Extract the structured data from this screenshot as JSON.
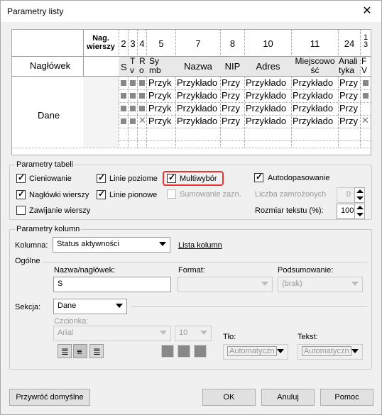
{
  "window": {
    "title": "Parametry listy"
  },
  "preview": {
    "header_row_label": "Nagłówek",
    "data_row_label": "Dane",
    "nag_wierszy": "Nag.\nwierszy",
    "columns": [
      {
        "num": "2",
        "name": "S"
      },
      {
        "num": "3",
        "name": "T\nv"
      },
      {
        "num": "4",
        "name": "R\no"
      },
      {
        "num": "5",
        "name": "Sy\nmb"
      },
      {
        "num": "7",
        "name": "Nazwa"
      },
      {
        "num": "8",
        "name": "NIP"
      },
      {
        "num": "10",
        "name": "Adres"
      },
      {
        "num": "11",
        "name": "Miejscowo\nść"
      },
      {
        "num": "24",
        "name": "Anali\ntyka"
      },
      {
        "num": "1\n3",
        "name": "F\nV"
      }
    ],
    "cells": {
      "symb": "Przyk",
      "nazwa": "Przykłado",
      "nip": "Przy",
      "adres": "Przykłado",
      "miejsc": "Przykłado",
      "anal": "Przy"
    }
  },
  "table_params": {
    "title": "Parametry tabeli",
    "cieniowanie": "Cieniowanie",
    "linie_poziome": "Linie poziome",
    "multiwybor": "Multiwybór",
    "autodopasowanie": "Autodopasowanie",
    "naglowki_wierszy": "Nagłówki wierszy",
    "linie_pionowe": "Linie pionowe",
    "sumowanie": "Sumowanie zazn.",
    "liczba_zamrozonych": "Liczba zamrożonych",
    "liczba_value": "0",
    "zawijanie": "Zawijanie wierszy",
    "rozmiar_tekstu": "Rozmiar tekstu (%):",
    "rozmiar_value": "100"
  },
  "column_params": {
    "title": "Parametry kolumn",
    "kolumna_label": "Kolumna:",
    "kolumna_value": "Status aktywności",
    "lista_kolumn": "Lista kolumn",
    "ogolne": "Ogólne",
    "nazwa_label": "Nazwa/nagłówek:",
    "nazwa_value": "S",
    "format_label": "Format:",
    "format_value": "",
    "podsumowanie_label": "Podsumowanie:",
    "podsumowanie_value": "(brak)",
    "sekcja_label": "Sekcja:",
    "sekcja_value": "Dane",
    "czcionka_label": "Czcionka:",
    "font_value": "Arial",
    "size_value": "10",
    "tlo_label": "Tło:",
    "tlo_value": "Automatyczn",
    "tekst_label": "Tekst:",
    "tekst_value": "Automatyczn"
  },
  "buttons": {
    "restore": "Przywróć domyślne",
    "ok": "OK",
    "cancel": "Anuluj",
    "help": "Pomoc"
  }
}
